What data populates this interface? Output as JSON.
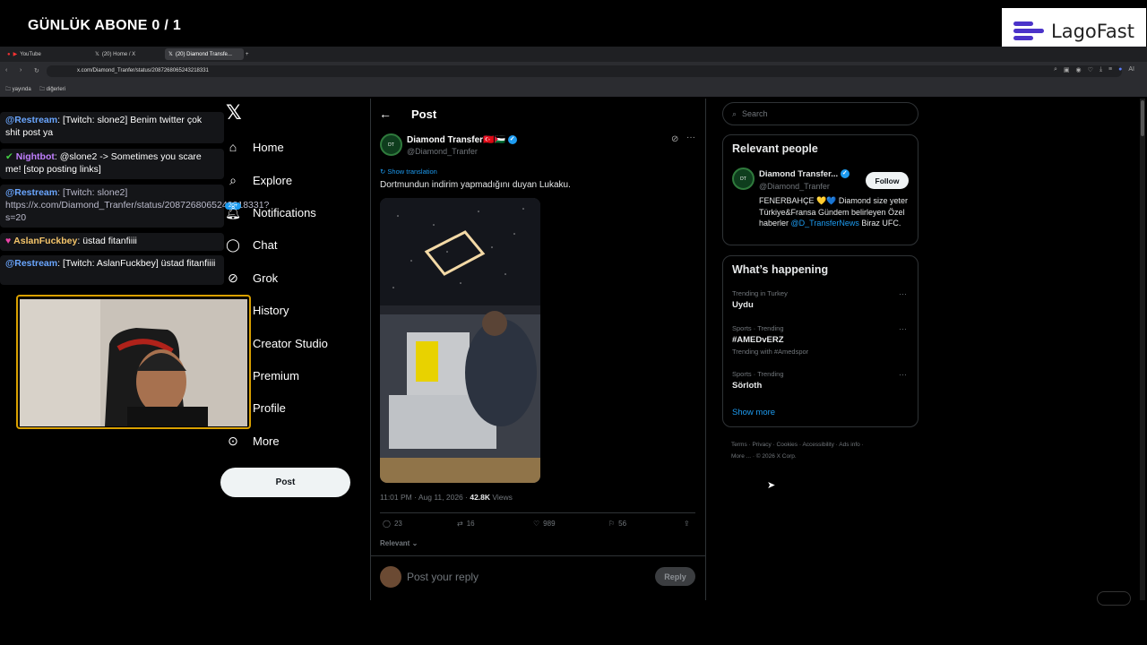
{
  "overlay": {
    "title": "GÜNLÜK ABONE 0 / 1",
    "brand": "LagoFast"
  },
  "browser": {
    "tabs": [
      {
        "label": "YouTube",
        "icon": "youtube-icon"
      },
      {
        "label": "(20) Home / X",
        "icon": "x-icon"
      },
      {
        "label": "(20) Diamond Transfe...",
        "icon": "x-icon"
      }
    ],
    "url": "x.com/Diamond_Tranfer/status/2087268065243218331",
    "bookmarks": [
      "yayında",
      "diğerleri"
    ],
    "ai_label": "AI"
  },
  "chat": [
    {
      "user": "@Restream",
      "text": ": [Twitch: slone2] Benim twitter çok shit post ya"
    },
    {
      "user": "Nightbot",
      "text": ": @slone2 -> Sometimes you scare me! [stop posting links]"
    },
    {
      "user": "@Restream",
      "text": ": [Twitch: slone2] https://x.com/Diamond_Tranfer/status/2087268065243218331?s=20"
    },
    {
      "user": "AslanFuckbey",
      "text": ": üstad fitanfiiii"
    },
    {
      "user": "@Restream",
      "text": ": [Twitch: AslanFuckbey] üstad fitanfiiii"
    }
  ],
  "nav": {
    "logo": "X",
    "badge": "20+",
    "items": [
      "Home",
      "Explore",
      "Notifications",
      "Chat",
      "Grok",
      "History",
      "Creator Studio",
      "Premium",
      "Profile",
      "More"
    ],
    "post_label": "Post"
  },
  "post": {
    "header": "Post",
    "author_name": "Diamond Transfer🇹🇷🇵🇸",
    "author_handle": "@Diamond_Tranfer",
    "show_translation": "Show translation",
    "text": "Dortmundun indirim yapmadığını duyan Lukaku.",
    "time": "11:01 PM · Aug 11, 2026 · ",
    "views_count": "42.8K",
    "views_label": " Views",
    "replies": "23",
    "reposts": "16",
    "likes": "989",
    "bookmarks": "56",
    "sort_label": "Relevant",
    "reply_placeholder": "Post your reply",
    "reply_button": "Reply"
  },
  "sidebar": {
    "search_placeholder": "Search",
    "relevant_title": "Relevant people",
    "person_name": "Diamond Transfer...",
    "person_handle": "@Diamond_Tranfer",
    "follow_label": "Follow",
    "bio_part1": "FENERBAHÇE 💛💙 Diamond size yeter Türkiye&Fransa Gündem belirleyen Özel haberler ",
    "bio_mention": "@D_TransferNews",
    "bio_part2": " Biraz UFC.",
    "happening_title": "What’s happening",
    "trends": [
      {
        "context": "Trending in Turkey",
        "name": "Uydu",
        "extra": ""
      },
      {
        "context": "Sports · Trending",
        "name": "#AMEDvERZ",
        "extra": "Trending with #Amedspor"
      },
      {
        "context": "Sports · Trending",
        "name": "Sörloth",
        "extra": ""
      }
    ],
    "show_more": "Show more",
    "footer_line1": "Terms  ·  Privacy  ·  Cookies  ·  Accessibility  ·  Ads info  ·",
    "footer_line2": "More ...  ·  © 2026 X Corp."
  },
  "colors": {
    "accent": "#1d9bf0",
    "background": "#000000",
    "muted": "#71767b"
  }
}
